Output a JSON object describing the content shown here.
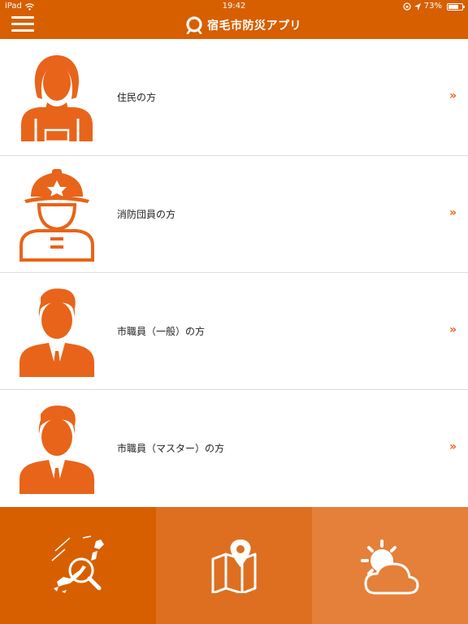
{
  "status_bar": {
    "device": "iPad",
    "time": "19:42",
    "battery": "73%",
    "battery_level": 0.73
  },
  "header": {
    "title": "宿毛市防災アプリ"
  },
  "list": {
    "items": [
      {
        "label": "住民の方",
        "icon": "resident-icon",
        "chevron": "»"
      },
      {
        "label": "消防団員の方",
        "icon": "firefighter-icon",
        "chevron": "»"
      },
      {
        "label": "市職員（一般）の方",
        "icon": "staff-general-icon",
        "chevron": "»"
      },
      {
        "label": "市職員（マスター）の方",
        "icon": "staff-master-icon",
        "chevron": "»"
      }
    ]
  },
  "tabs": [
    {
      "icon": "japan-map-search-icon"
    },
    {
      "icon": "map-pin-icon"
    },
    {
      "icon": "weather-icon"
    }
  ],
  "colors": {
    "header": "#D75F00",
    "accent": "#E8641A",
    "tab1": "#D75F00",
    "tab2": "#DE6F21",
    "tab3": "#E4803A"
  }
}
